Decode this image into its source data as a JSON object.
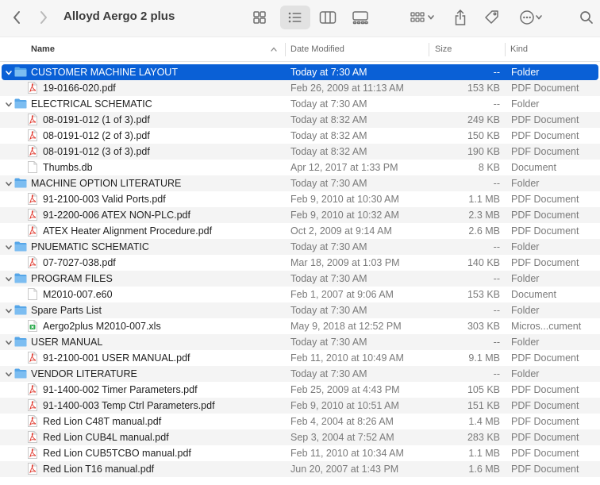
{
  "window": {
    "title": "Alloyd Aergo 2 plus"
  },
  "toolbar": {
    "back_icon": "chevron-left-icon",
    "forward_icon": "chevron-right-icon",
    "view_modes": [
      "icons",
      "list",
      "columns",
      "gallery"
    ],
    "selected_view": "list"
  },
  "columns": {
    "name": "Name",
    "date": "Date Modified",
    "size": "Size",
    "kind": "Kind",
    "sort_indicator": "^"
  },
  "colors": {
    "selection": "#0a60d6",
    "folder": "#56a6e8",
    "pdf": "#e0362b",
    "xls": "#2eaa4f"
  },
  "rows": [
    {
      "level": 0,
      "type": "folder",
      "name": "CUSTOMER MACHINE LAYOUT",
      "date": "Today at 7:30 AM",
      "size": "--",
      "kind": "Folder",
      "selected": true
    },
    {
      "level": 1,
      "type": "pdf",
      "name": "19-0166-020.pdf",
      "date": "Feb 26, 2009 at 11:13 AM",
      "size": "153 KB",
      "kind": "PDF Document"
    },
    {
      "level": 0,
      "type": "folder",
      "name": "ELECTRICAL SCHEMATIC",
      "date": "Today at 7:30 AM",
      "size": "--",
      "kind": "Folder"
    },
    {
      "level": 1,
      "type": "pdf",
      "name": "08-0191-012 (1 of 3).pdf",
      "date": "Today at 8:32 AM",
      "size": "249 KB",
      "kind": "PDF Document"
    },
    {
      "level": 1,
      "type": "pdf",
      "name": "08-0191-012 (2 of 3).pdf",
      "date": "Today at 8:32 AM",
      "size": "150 KB",
      "kind": "PDF Document"
    },
    {
      "level": 1,
      "type": "pdf",
      "name": "08-0191-012 (3 of 3).pdf",
      "date": "Today at 8:32 AM",
      "size": "190 KB",
      "kind": "PDF Document"
    },
    {
      "level": 1,
      "type": "doc",
      "name": "Thumbs.db",
      "date": "Apr 12, 2017 at 1:33 PM",
      "size": "8 KB",
      "kind": "Document"
    },
    {
      "level": 0,
      "type": "folder",
      "name": "MACHINE OPTION LITERATURE",
      "date": "Today at 7:30 AM",
      "size": "--",
      "kind": "Folder"
    },
    {
      "level": 1,
      "type": "pdf",
      "name": "91-2100-003 Valid Ports.pdf",
      "date": "Feb 9, 2010 at 10:30 AM",
      "size": "1.1 MB",
      "kind": "PDF Document"
    },
    {
      "level": 1,
      "type": "pdf",
      "name": "91-2200-006 ATEX NON-PLC.pdf",
      "date": "Feb 9, 2010 at 10:32 AM",
      "size": "2.3 MB",
      "kind": "PDF Document"
    },
    {
      "level": 1,
      "type": "pdf",
      "name": "ATEX Heater Alignment Procedure.pdf",
      "date": "Oct 2, 2009 at 9:14 AM",
      "size": "2.6 MB",
      "kind": "PDF Document"
    },
    {
      "level": 0,
      "type": "folder",
      "name": "PNUEMATIC SCHEMATIC",
      "date": "Today at 7:30 AM",
      "size": "--",
      "kind": "Folder"
    },
    {
      "level": 1,
      "type": "pdf",
      "name": "07-7027-038.pdf",
      "date": "Mar 18, 2009 at 1:03 PM",
      "size": "140 KB",
      "kind": "PDF Document"
    },
    {
      "level": 0,
      "type": "folder",
      "name": "PROGRAM FILES",
      "date": "Today at 7:30 AM",
      "size": "--",
      "kind": "Folder"
    },
    {
      "level": 1,
      "type": "doc",
      "name": "M2010-007.e60",
      "date": "Feb 1, 2007 at 9:06 AM",
      "size": "153 KB",
      "kind": "Document"
    },
    {
      "level": 0,
      "type": "folder",
      "name": "Spare Parts List",
      "date": "Today at 7:30 AM",
      "size": "--",
      "kind": "Folder"
    },
    {
      "level": 1,
      "type": "xls",
      "name": "Aergo2plus M2010-007.xls",
      "date": "May 9, 2018 at 12:52 PM",
      "size": "303 KB",
      "kind": "Micros...cument"
    },
    {
      "level": 0,
      "type": "folder",
      "name": "USER MANUAL",
      "date": "Today at 7:30 AM",
      "size": "--",
      "kind": "Folder"
    },
    {
      "level": 1,
      "type": "pdf",
      "name": "91-2100-001 USER MANUAL.pdf",
      "date": "Feb 11, 2010 at 10:49 AM",
      "size": "9.1 MB",
      "kind": "PDF Document"
    },
    {
      "level": 0,
      "type": "folder",
      "name": "VENDOR LITERATURE",
      "date": "Today at 7:30 AM",
      "size": "--",
      "kind": "Folder"
    },
    {
      "level": 1,
      "type": "pdf",
      "name": "91-1400-002 Timer Parameters.pdf",
      "date": "Feb 25, 2009 at 4:43 PM",
      "size": "105 KB",
      "kind": "PDF Document"
    },
    {
      "level": 1,
      "type": "pdf",
      "name": "91-1400-003 Temp Ctrl Parameters.pdf",
      "date": "Feb 9, 2010 at 10:51 AM",
      "size": "151 KB",
      "kind": "PDF Document"
    },
    {
      "level": 1,
      "type": "pdf",
      "name": "Red Lion C48T manual.pdf",
      "date": "Feb 4, 2004 at 8:26 AM",
      "size": "1.4 MB",
      "kind": "PDF Document"
    },
    {
      "level": 1,
      "type": "pdf",
      "name": "Red Lion CUB4L manual.pdf",
      "date": "Sep 3, 2004 at 7:52 AM",
      "size": "283 KB",
      "kind": "PDF Document"
    },
    {
      "level": 1,
      "type": "pdf",
      "name": "Red Lion CUB5TCBO manual.pdf",
      "date": "Feb 11, 2010 at 10:34 AM",
      "size": "1.1 MB",
      "kind": "PDF Document"
    },
    {
      "level": 1,
      "type": "pdf",
      "name": "Red Lion T16 manual.pdf",
      "date": "Jun 20, 2007 at 1:43 PM",
      "size": "1.6 MB",
      "kind": "PDF Document"
    }
  ]
}
